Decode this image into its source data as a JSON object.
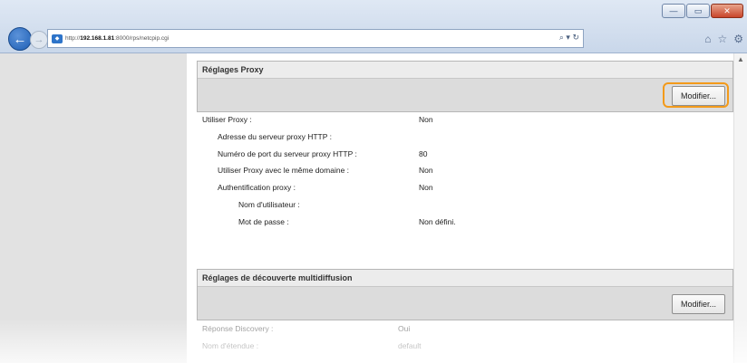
{
  "browser": {
    "url": "http://192.168.1.81:8000/rps/netcpip.cgi",
    "url_host": "192.168.1.81",
    "url_prefix": "http://",
    "url_suffix": ":8000/rps/netcpip.cgi",
    "search_icons": "⌕ ▾ ↻",
    "window_buttons": [
      "—",
      "▭",
      "✕"
    ],
    "tool_icons": [
      "⌂",
      "☆",
      "⚙"
    ]
  },
  "proxy_section": {
    "title": "Réglages Proxy",
    "edit_label": "Modifier...",
    "rows": [
      {
        "label": "Utiliser Proxy :",
        "value": "Non"
      },
      {
        "label": "Adresse du serveur proxy HTTP :",
        "value": ""
      },
      {
        "label": "Numéro de port du serveur proxy HTTP :",
        "value": "80"
      },
      {
        "label": "Utiliser Proxy avec le même domaine :",
        "value": "Non"
      },
      {
        "label": "Authentification proxy :",
        "value": "Non"
      },
      {
        "label": "Nom d'utilisateur :",
        "value": ""
      },
      {
        "label": "Mot de passe :",
        "value": "Non défini."
      }
    ]
  },
  "discovery_section": {
    "title": "Réglages de découverte multidiffusion",
    "edit_label": "Modifier...",
    "rows": [
      {
        "label": "Réponse Discovery :",
        "value": "Oui"
      },
      {
        "label": "Nom d'étendue :",
        "value": "default"
      }
    ]
  }
}
